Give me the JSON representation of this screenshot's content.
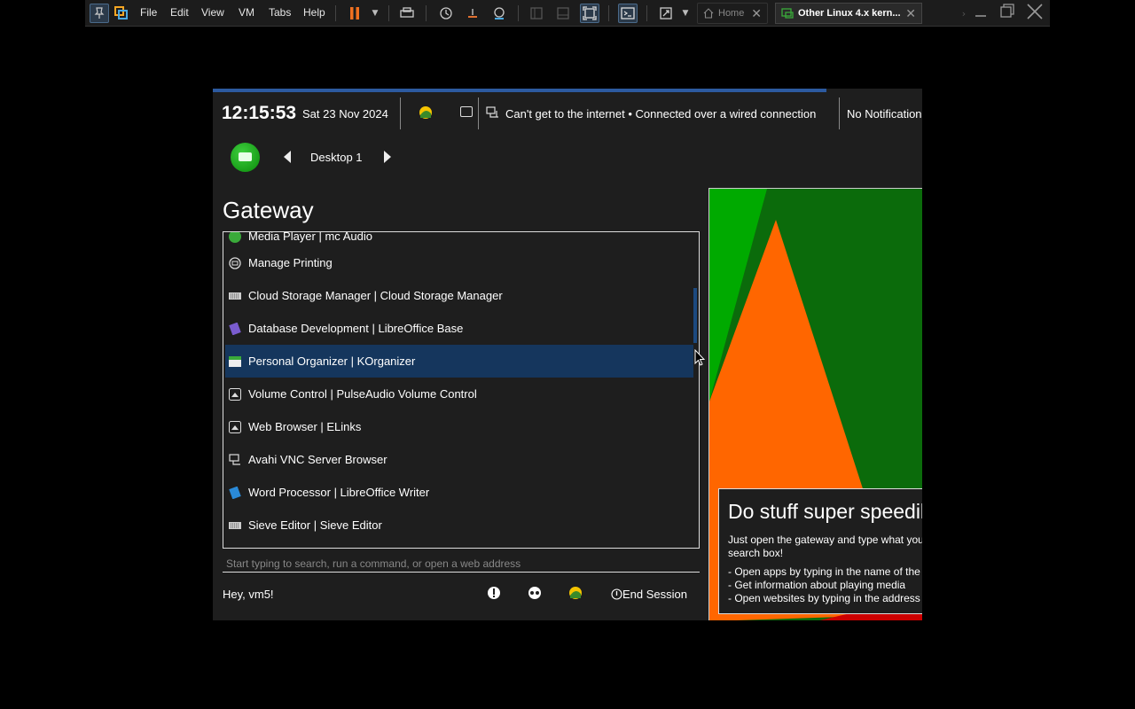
{
  "vm_toolbar": {
    "menus": [
      "File",
      "Edit",
      "View",
      "VM",
      "Tabs",
      "Help"
    ],
    "tabs": {
      "home": "Home",
      "active": "Other Linux 4.x kern..."
    }
  },
  "guest": {
    "topbar": {
      "time": "12:15:53",
      "date": "Sat 23 Nov 2024",
      "network_status": "Can't get to the internet • Connected over a wired connection",
      "notifications": "No Notifications"
    },
    "desktop": {
      "label": "Desktop 1"
    },
    "gateway": {
      "title": "Gateway",
      "partial_item": "Media Player | mc Audio",
      "items": [
        {
          "label": "Manage Printing",
          "icon": "printer-icon",
          "color": "#dddddd",
          "selected": false
        },
        {
          "label": "Cloud Storage Manager | Cloud Storage Manager",
          "icon": "storage-icon",
          "color": "#cccccc",
          "selected": false
        },
        {
          "label": "Database Development | LibreOffice Base",
          "icon": "libreoffice-base-icon",
          "color": "#7a5ccf",
          "selected": false
        },
        {
          "label": "Personal Organizer | KOrganizer",
          "icon": "calendar-icon",
          "color": "#3aaa3a",
          "selected": true
        },
        {
          "label": "Volume Control | PulseAudio Volume Control",
          "icon": "volume-icon",
          "color": "#dddddd",
          "selected": false
        },
        {
          "label": "Web Browser | ELinks",
          "icon": "browser-icon",
          "color": "#dddddd",
          "selected": false
        },
        {
          "label": "Avahi VNC Server Browser",
          "icon": "vnc-icon",
          "color": "#dddddd",
          "selected": false
        },
        {
          "label": "Word Processor | LibreOffice Writer",
          "icon": "libreoffice-writer-icon",
          "color": "#2a8ad8",
          "selected": false
        },
        {
          "label": "Sieve Editor | Sieve Editor",
          "icon": "editor-icon",
          "color": "#cccccc",
          "selected": false
        }
      ],
      "search_placeholder": "Start typing to search, run a command, or open a web address"
    },
    "bottom": {
      "greeting": "Hey, vm5!",
      "end_session": "End Session"
    },
    "promo": {
      "title": "Do stuff super speedily",
      "body": "Just open the gateway and type what you want in the search box!",
      "bullets": [
        "- Open apps by typing in the name of the app",
        "- Get information about playing media",
        "- Open websites by typing in the address"
      ]
    },
    "colors": {
      "progress": "#2c5aa0",
      "selection": "#15365d",
      "promo_green_dark": "#0b6b0b",
      "promo_green_light": "#00aa00",
      "promo_orange": "#ff6600",
      "promo_red": "#cc0000"
    }
  }
}
